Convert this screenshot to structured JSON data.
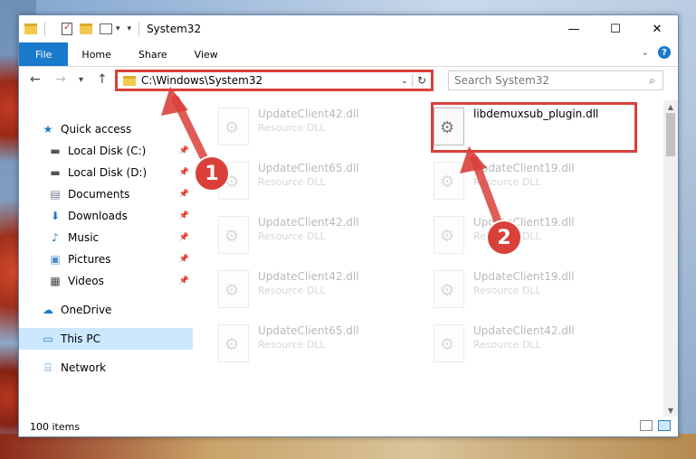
{
  "window": {
    "title": "System32",
    "controls": {
      "minimize": "—",
      "maximize": "☐",
      "close": "✕"
    }
  },
  "ribbon": {
    "tabs": [
      "File",
      "Home",
      "Share",
      "View"
    ],
    "help": "?"
  },
  "navigation": {
    "back": "←",
    "forward": "→",
    "recent": "▾",
    "up": "↑",
    "address": "C:\\Windows\\System32",
    "refresh": "↻",
    "search_placeholder": "Search System32"
  },
  "sidebar": {
    "items": [
      {
        "label": "Quick access",
        "icon": "star-icon",
        "glyph": "★",
        "color": "#1979ca"
      },
      {
        "label": "Local Disk (C:)",
        "icon": "drive-icon",
        "glyph": "▬",
        "color": "#555555",
        "pinned": true
      },
      {
        "label": "Local Disk (D:)",
        "icon": "drive-icon",
        "glyph": "▬",
        "color": "#555555",
        "pinned": true
      },
      {
        "label": "Documents",
        "icon": "documents-icon",
        "glyph": "▤",
        "color": "#6b7b8c",
        "pinned": true
      },
      {
        "label": "Downloads",
        "icon": "download-icon",
        "glyph": "⬇",
        "color": "#1979ca",
        "pinned": true
      },
      {
        "label": "Music",
        "icon": "music-icon",
        "glyph": "♪",
        "color": "#1979ca",
        "pinned": true
      },
      {
        "label": "Pictures",
        "icon": "pictures-icon",
        "glyph": "▣",
        "color": "#4b8ec9",
        "pinned": true
      },
      {
        "label": "Videos",
        "icon": "videos-icon",
        "glyph": "▦",
        "color": "#444444",
        "pinned": true
      },
      {
        "label": "OneDrive",
        "icon": "cloud-icon",
        "glyph": "☁",
        "color": "#1979ca"
      },
      {
        "label": "This PC",
        "icon": "computer-icon",
        "glyph": "▭",
        "color": "#2a7fc9",
        "selected": true
      },
      {
        "label": "Network",
        "icon": "network-icon",
        "glyph": "⌸",
        "color": "#2a7fc9"
      }
    ]
  },
  "files": [
    {
      "name": "UpdateClient42.dll",
      "type": "Resource DLL"
    },
    {
      "name": "libdemuxsub_plugin.dll",
      "type": "",
      "highlighted": true
    },
    {
      "name": "UpdateClient65.dll",
      "type": "Resource DLL"
    },
    {
      "name": "UpdateClient19.dll",
      "type": "Resource DLL"
    },
    {
      "name": "UpdateClient42.dll",
      "type": "Resource DLL"
    },
    {
      "name": "UpdateClient19.dll",
      "type": "Resource DLL"
    },
    {
      "name": "UpdateClient42.dll",
      "type": "Resource DLL"
    },
    {
      "name": "UpdateClient19.dll",
      "type": "Resource DLL"
    },
    {
      "name": "UpdateClient65.dll",
      "type": "Resource DLL"
    },
    {
      "name": "UpdateClient42.dll",
      "type": "Resource DLL"
    }
  ],
  "status": {
    "item_count": "100 items"
  },
  "annotations": [
    {
      "label": "1",
      "color": "#d9403a"
    },
    {
      "label": "2",
      "color": "#d9403a"
    }
  ]
}
